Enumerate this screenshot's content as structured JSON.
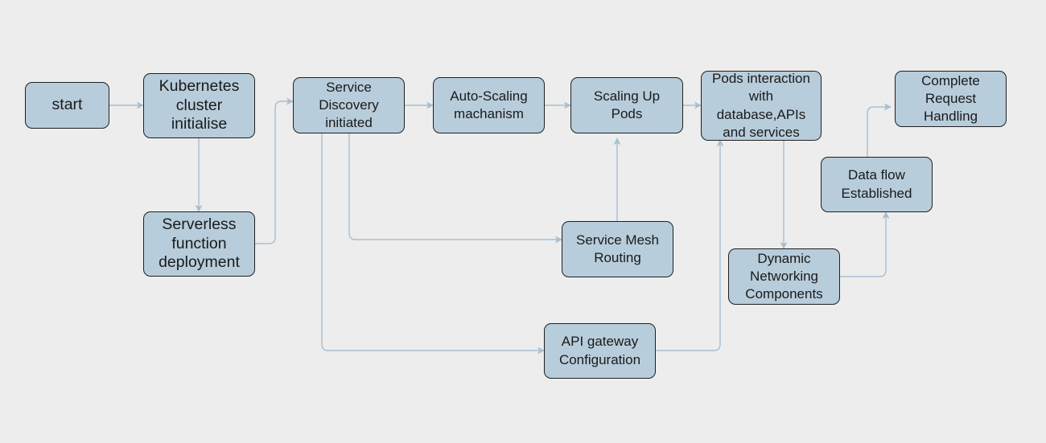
{
  "diagram": {
    "type": "flowchart",
    "colors": {
      "background": "#ededed",
      "node_fill": "#b8cddb",
      "node_border": "#1f1f1f",
      "edge": "#a6bfd3",
      "text": "#1a1a1a"
    },
    "nodes": {
      "start": {
        "label": "start"
      },
      "k8s": {
        "label": "Kubernetes\ncluster\ninitialise"
      },
      "serverless": {
        "label": "Serverless\nfunction\ndeployment"
      },
      "discovery": {
        "label": "Service\nDiscovery\ninitiated"
      },
      "autoscale": {
        "label": "Auto-Scaling\nmachanism"
      },
      "scaleup": {
        "label": "Scaling Up\nPods"
      },
      "mesh": {
        "label": "Service Mesh\nRouting"
      },
      "apigw": {
        "label": "API gateway\nConfiguration"
      },
      "pods": {
        "label": "Pods interaction\nwith\ndatabase,APIs\nand services"
      },
      "dynnet": {
        "label": "Dynamic\nNetworking\nComponents"
      },
      "dataflow": {
        "label": "Data flow\nEstablished"
      },
      "complete": {
        "label": "Complete\nRequest\nHandling"
      }
    },
    "edges": [
      {
        "from": "start",
        "to": "k8s"
      },
      {
        "from": "k8s",
        "to": "serverless"
      },
      {
        "from": "serverless",
        "to": "discovery"
      },
      {
        "from": "discovery",
        "to": "autoscale"
      },
      {
        "from": "autoscale",
        "to": "scaleup"
      },
      {
        "from": "discovery",
        "to": "mesh"
      },
      {
        "from": "mesh",
        "to": "scaleup"
      },
      {
        "from": "discovery",
        "to": "apigw"
      },
      {
        "from": "scaleup",
        "to": "pods"
      },
      {
        "from": "apigw",
        "to": "pods"
      },
      {
        "from": "pods",
        "to": "dynnet"
      },
      {
        "from": "dynnet",
        "to": "dataflow"
      },
      {
        "from": "dataflow",
        "to": "complete"
      }
    ]
  }
}
